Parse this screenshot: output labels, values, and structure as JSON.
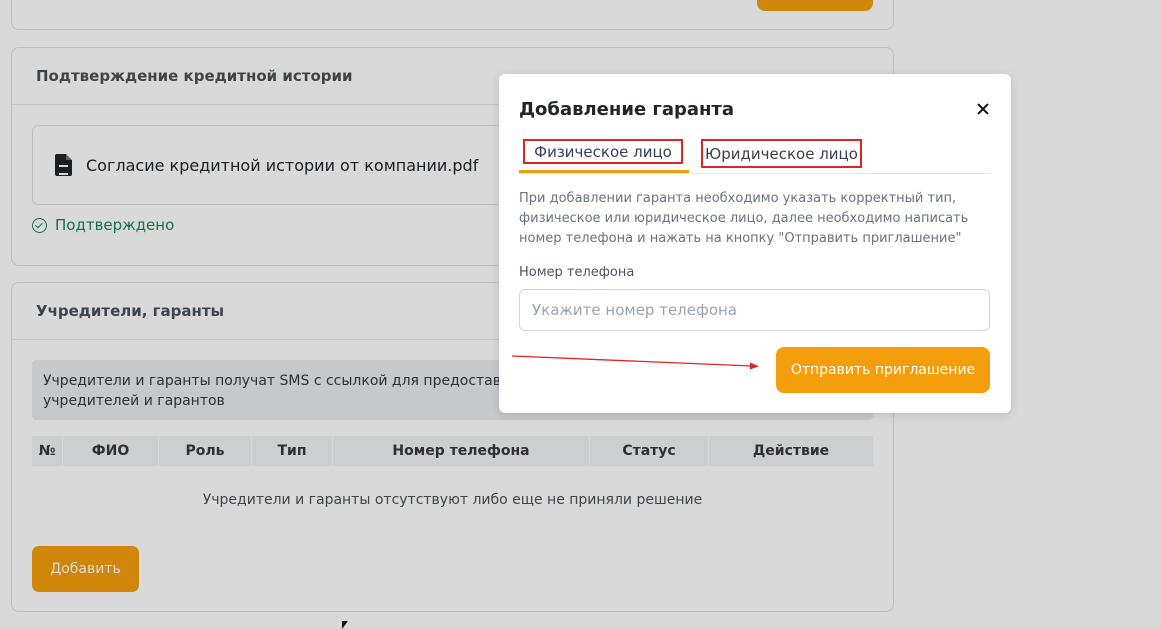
{
  "background": {
    "credit_history": {
      "title": "Подтверждение кредитной истории",
      "file_name": "Согласие кредитной истории от компании.pdf",
      "status": "Подтверждено"
    },
    "founders": {
      "title": "Учредители, гаранты",
      "info_line1": "Учредители и гаранты получат SMS с ссылкой для предоставления",
      "info_line2": "учредителей и гарантов",
      "columns": [
        "№",
        "ФИО",
        "Роль",
        "Тип",
        "Номер телефона",
        "Статус",
        "Действие"
      ],
      "empty_text": "Учредители и гаранты отсутствуют либо еще не приняли решение",
      "add_label": "Добавить"
    }
  },
  "modal": {
    "title": "Добавление гаранта",
    "tabs": [
      {
        "label": "Физическое лицо",
        "active": true
      },
      {
        "label": "Юридическое лицо",
        "active": false
      }
    ],
    "description": "При добавлении гаранта необходимо указать корректный тип, физическое или юридическое лицо, далее необходимо написать номер телефона и нажать на кнопку \"Отправить приглашение\"",
    "phone_label": "Номер телефона",
    "phone_placeholder": "Укажите номер телефона",
    "phone_value": "",
    "send_label": "Отправить приглашение"
  },
  "colors": {
    "accent": "#f59e0b",
    "success": "#198754",
    "annotation": "#dc2626"
  },
  "icons": [
    "file-icon",
    "check-circle-icon",
    "close-icon"
  ]
}
